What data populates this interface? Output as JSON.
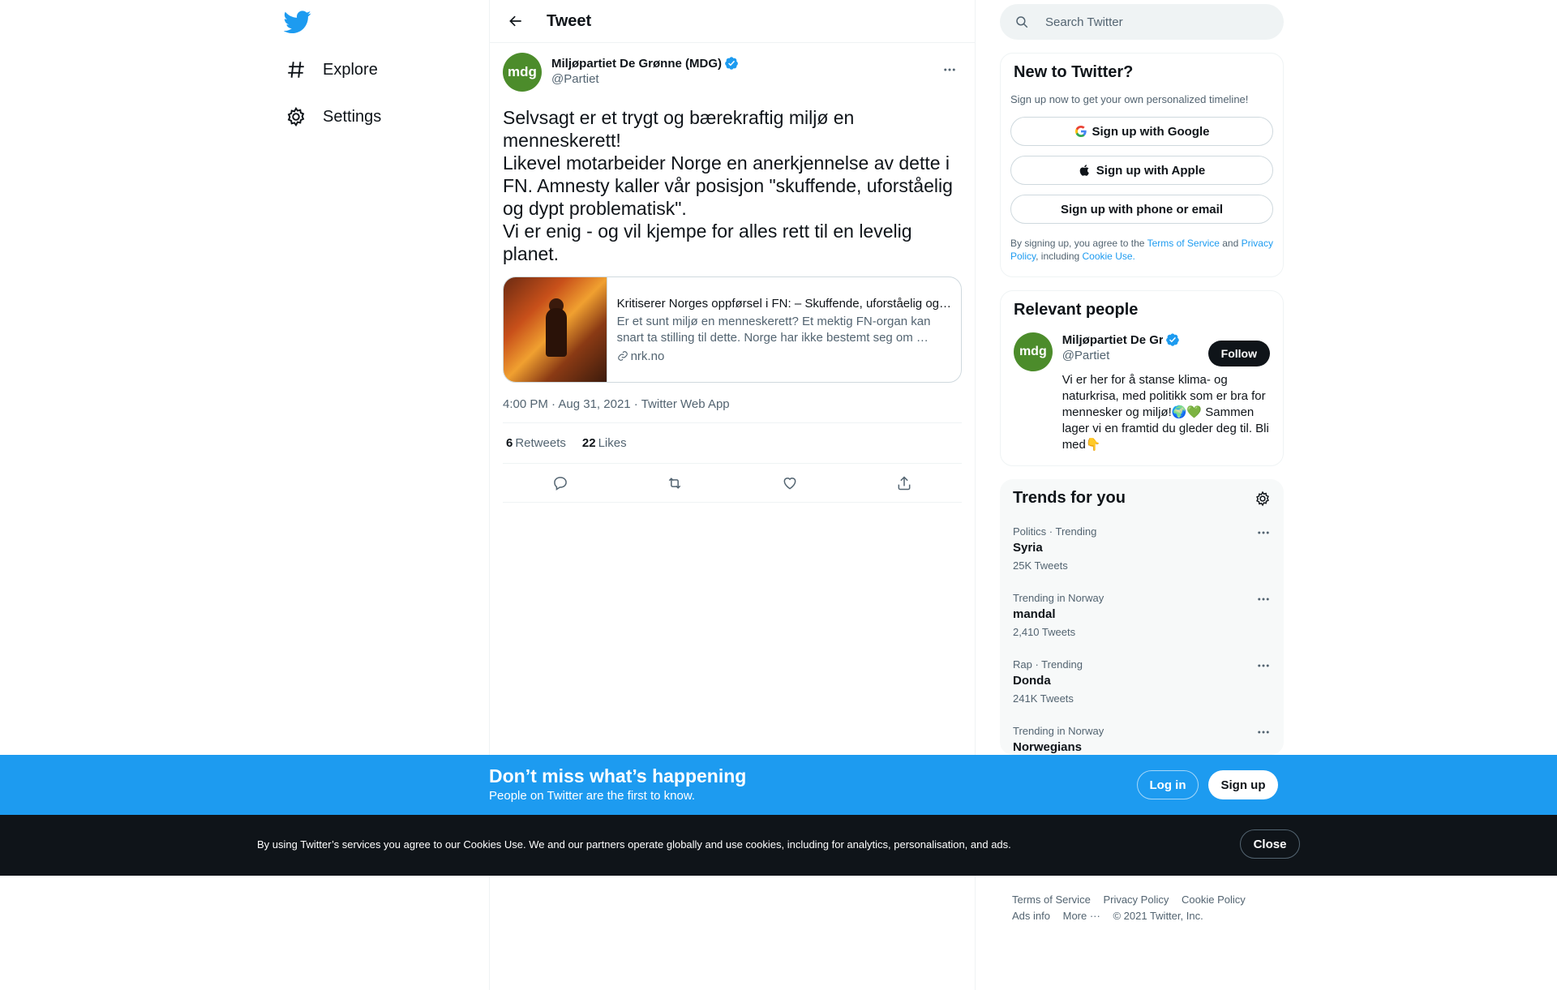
{
  "nav": {
    "items": [
      {
        "label": "Explore",
        "icon": "hashtag-icon"
      },
      {
        "label": "Settings",
        "icon": "gear-icon"
      }
    ]
  },
  "header": {
    "title": "Tweet"
  },
  "tweet": {
    "author_name": "Miljøpartiet De Grønne (MDG)",
    "author_handle": "@Partiet",
    "avatar_text": "mdg",
    "text": "Selvsagt er et trygt og bærekraftig miljø en menneskerett!\nLikevel motarbeider Norge en anerkjennelse av dette i FN. Amnesty kaller vår posisjon \"skuffende, uforståelig og dypt problematisk\".\nVi er enig - og vil kjempe for alles rett til en levelig planet.",
    "card": {
      "title": "Kritiserer Norges oppførsel i FN: – Skuffende, uforståelig og…",
      "description": "Er et sunt miljø en menneskerett? Et mektig FN-organ kan snart ta stilling til dette. Norge har ikke bestemt seg om …",
      "domain": "nrk.no"
    },
    "time": "4:00 PM",
    "date": "Aug 31, 2021",
    "source": "Twitter Web App",
    "retweets_count": "6",
    "retweets_label": "Retweets",
    "likes_count": "22",
    "likes_label": "Likes"
  },
  "search": {
    "placeholder": "Search Twitter"
  },
  "signup": {
    "title": "New to Twitter?",
    "subtitle": "Sign up now to get your own personalized timeline!",
    "google": "Sign up with Google",
    "apple": "Sign up with Apple",
    "phone": "Sign up with phone or email",
    "legal_pre": "By signing up, you agree to the ",
    "terms": "Terms of Service",
    "and": " and ",
    "privacy": "Privacy Policy",
    "including": ", including ",
    "cookie": "Cookie Use."
  },
  "people": {
    "title": "Relevant people",
    "name": "Miljøpartiet De Grønne (MDG)",
    "handle": "@Partiet",
    "follow": "Follow",
    "bio": "Vi er her for å stanse klima- og naturkrisa, med politikk som er bra for mennesker og miljø!🌍💚 Sammen lager vi en framtid du gleder deg til. Bli med👇"
  },
  "trends": {
    "title": "Trends for you",
    "items": [
      {
        "context": "Politics · Trending",
        "name": "Syria",
        "count": "25K Tweets"
      },
      {
        "context": "Trending in Norway",
        "name": "mandal",
        "count": "2,410 Tweets"
      },
      {
        "context": "Rap · Trending",
        "name": "Donda",
        "count": "241K Tweets"
      },
      {
        "context": "Trending in Norway",
        "name": "Norwegians",
        "count": ""
      }
    ]
  },
  "footer": {
    "terms": "Terms of Service",
    "privacy": "Privacy Policy",
    "cookie": "Cookie Policy",
    "ads": "Ads info",
    "more": "More ···",
    "copyright": "© 2021 Twitter, Inc."
  },
  "banner": {
    "title": "Don’t miss what’s happening",
    "subtitle": "People on Twitter are the first to know.",
    "login": "Log in",
    "signup": "Sign up"
  },
  "cookie_bar": {
    "text": "By using Twitter’s services you agree to our Cookies Use. We and our partners operate globally and use cookies, including for analytics, personalisation, and ads.",
    "close": "Close"
  },
  "colors": {
    "accent": "#1d9bf0",
    "avatar_green": "#4c8c2b",
    "text": "#0f1419",
    "muted": "#536471"
  }
}
